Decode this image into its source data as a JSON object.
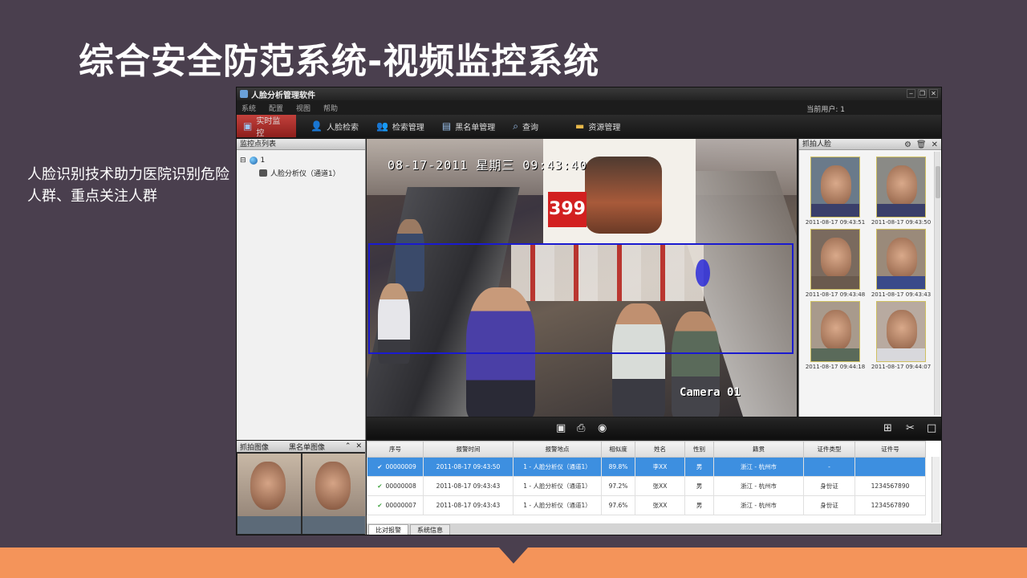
{
  "slide": {
    "title": "综合安全防范系统-视频监控系统",
    "note": "人脸识别技术助力医院识别危险人群、重点关注人群"
  },
  "window": {
    "title": "人脸分析管理软件",
    "current_user": "当前用户: 1"
  },
  "menu": [
    "系统",
    "配置",
    "视图",
    "帮助"
  ],
  "toolbar": [
    {
      "label": "实时监控",
      "icon": "monitor-icon",
      "active": true
    },
    {
      "label": "人脸检索",
      "icon": "person-search-icon"
    },
    {
      "label": "检索管理",
      "icon": "person-manage-icon"
    },
    {
      "label": "黑名单管理",
      "icon": "blacklist-icon"
    },
    {
      "label": "查询",
      "icon": "magnifier-icon"
    },
    {
      "label": "资源管理",
      "icon": "folder-icon"
    }
  ],
  "monitor_list": {
    "header": "监控点列表",
    "root": "1",
    "child": "人脸分析仪（通道1）"
  },
  "video": {
    "osd_time": "08-17-2011 星期三 09:43:40",
    "ad_price": "399",
    "camera_label": "Camera 01"
  },
  "capture": {
    "header": "抓拍人脸",
    "faces": [
      {
        "time": "2011-08-17 09:43:51"
      },
      {
        "time": "2011-08-17 09:43:50"
      },
      {
        "time": "2011-08-17 09:43:48"
      },
      {
        "time": "2011-08-17 09:43:43"
      },
      {
        "time": "2011-08-17 09:44:18"
      },
      {
        "time": "2011-08-17 09:44:07"
      }
    ]
  },
  "alarm_images": {
    "left_label": "抓拍图像",
    "right_label": "黑名单图像"
  },
  "alarm_table": {
    "columns": [
      "序号",
      "报警时间",
      "报警地点",
      "相似度",
      "姓名",
      "性别",
      "籍贯",
      "证件类型",
      "证件号"
    ],
    "rows": [
      {
        "id": "00000009",
        "time": "2011-08-17 09:43:50",
        "place": "1 - 人脸分析仪（通道1）",
        "similarity": "89.8%",
        "name": "李XX",
        "gender": "男",
        "origin": "浙江 - 杭州市",
        "doc_type": "-",
        "doc_no": "",
        "selected": true
      },
      {
        "id": "00000008",
        "time": "2011-08-17 09:43:43",
        "place": "1 - 人脸分析仪（通道1）",
        "similarity": "97.2%",
        "name": "张XX",
        "gender": "男",
        "origin": "浙江 - 杭州市",
        "doc_type": "身份证",
        "doc_no": "1234567890"
      },
      {
        "id": "00000007",
        "time": "2011-08-17 09:43:43",
        "place": "1 - 人脸分析仪（通道1）",
        "similarity": "97.6%",
        "name": "张XX",
        "gender": "男",
        "origin": "浙江 - 杭州市",
        "doc_type": "身份证",
        "doc_no": "1234567890"
      }
    ]
  },
  "bottom_tabs": [
    "比对报警",
    "系统信息"
  ],
  "colors": {
    "slide_bg": "#4a3f4e",
    "accent_orange": "#f4945a",
    "active_tab_red": "#b8322e",
    "selected_row_blue": "#3d8fe0",
    "roi_blue": "#1a1ad0"
  }
}
